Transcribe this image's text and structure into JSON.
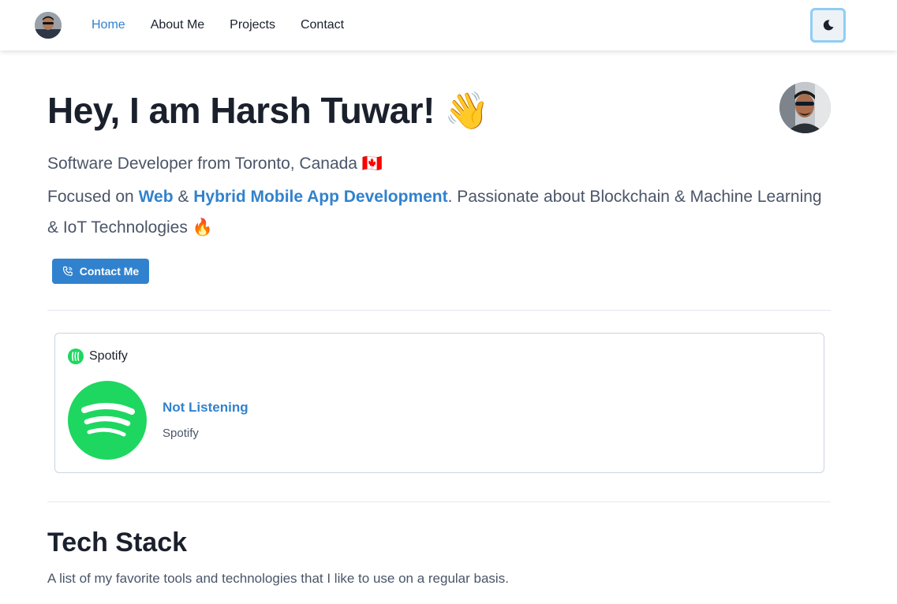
{
  "nav": {
    "links": [
      {
        "label": "Home",
        "active": true
      },
      {
        "label": "About Me",
        "active": false
      },
      {
        "label": "Projects",
        "active": false
      },
      {
        "label": "Contact",
        "active": false
      }
    ],
    "theme_toggle_icon": "moon-icon"
  },
  "hero": {
    "title": "Hey, I am Harsh Tuwar!",
    "title_emoji": "👋",
    "subtitle": "Software Developer from Toronto, Canada",
    "subtitle_flag": "🇨🇦",
    "focus_prefix": "Focused on ",
    "focus_web": "Web",
    "focus_amp": " & ",
    "focus_mobile": "Hybrid Mobile App Development",
    "focus_suffix": ". Passionate about Blockchain & Machine Learning & IoT Technologies ",
    "focus_emoji": "🔥",
    "contact_button": "Contact Me"
  },
  "spotify": {
    "header_label": "Spotify",
    "track_title": "Not Listening",
    "track_artist": "Spotify"
  },
  "tech_stack": {
    "title": "Tech Stack",
    "description": "A list of my favorite tools and technologies that I like to use on a regular basis."
  },
  "colors": {
    "accent": "#3182ce",
    "spotify_green": "#1ed760",
    "text": "#1a202c",
    "muted": "#4a5568"
  }
}
